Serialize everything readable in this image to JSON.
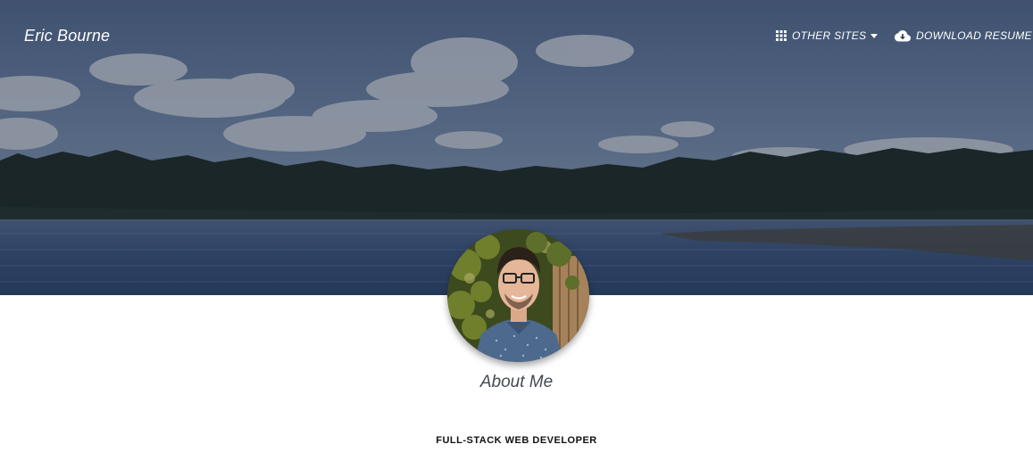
{
  "navbar": {
    "brand": "Eric Bourne",
    "other_sites": {
      "label": "OTHER SITES",
      "icon": "grid-icon"
    },
    "download_resume": {
      "label": "DOWNLOAD RESUME",
      "icon": "cloud-download-icon"
    }
  },
  "hero": {
    "image": "lake-forest-landscape",
    "avatar": "profile-photo"
  },
  "about": {
    "title": "About Me",
    "subtitle": "FULL-STACK WEB DEVELOPER"
  },
  "colors": {
    "overlay": "#1e2a40",
    "sky": "#6f86a8",
    "water": "#2f4870",
    "forest": "#162318",
    "heading_text": "#444a52"
  }
}
